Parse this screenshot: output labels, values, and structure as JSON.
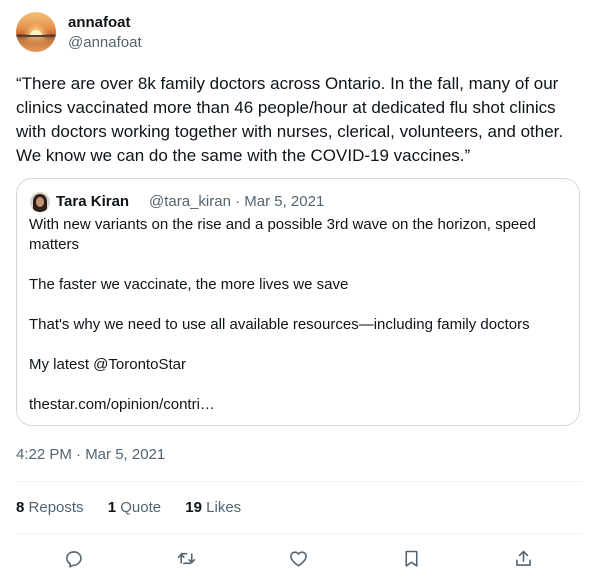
{
  "author": {
    "display_name": "annafoat",
    "handle": "@annafoat"
  },
  "tweet": {
    "text": "“There are over 8k family doctors across Ontario. In the fall, many of our clinics vaccinated more than 46 people/hour at dedicated flu shot clinics with doctors working together with nurses, clerical, volunteers, and other. We know we can do the same with the COVID-19 vaccines.”",
    "timestamp": "4:22 PM · Mar 5, 2021"
  },
  "quote": {
    "display_name": "Tara Kiran",
    "meta": "@tara_kiran · Mar 5, 2021",
    "paragraphs": [
      "With new variants on the rise and a possible 3rd wave on the horizon, speed matters",
      "The faster we vaccinate, the more lives we save",
      "That's why we need to use all available resources—including family doctors",
      "My latest @TorontoStar",
      "thestar.com/opinion/contri…"
    ]
  },
  "stats": {
    "reposts_count": "8",
    "reposts_label": "Reposts",
    "quotes_count": "1",
    "quotes_label": "Quote",
    "likes_count": "19",
    "likes_label": "Likes"
  },
  "actions": {
    "icons": [
      "reply-icon",
      "repost-icon",
      "like-icon",
      "bookmark-icon",
      "share-icon"
    ],
    "icon_color": "#536471"
  }
}
